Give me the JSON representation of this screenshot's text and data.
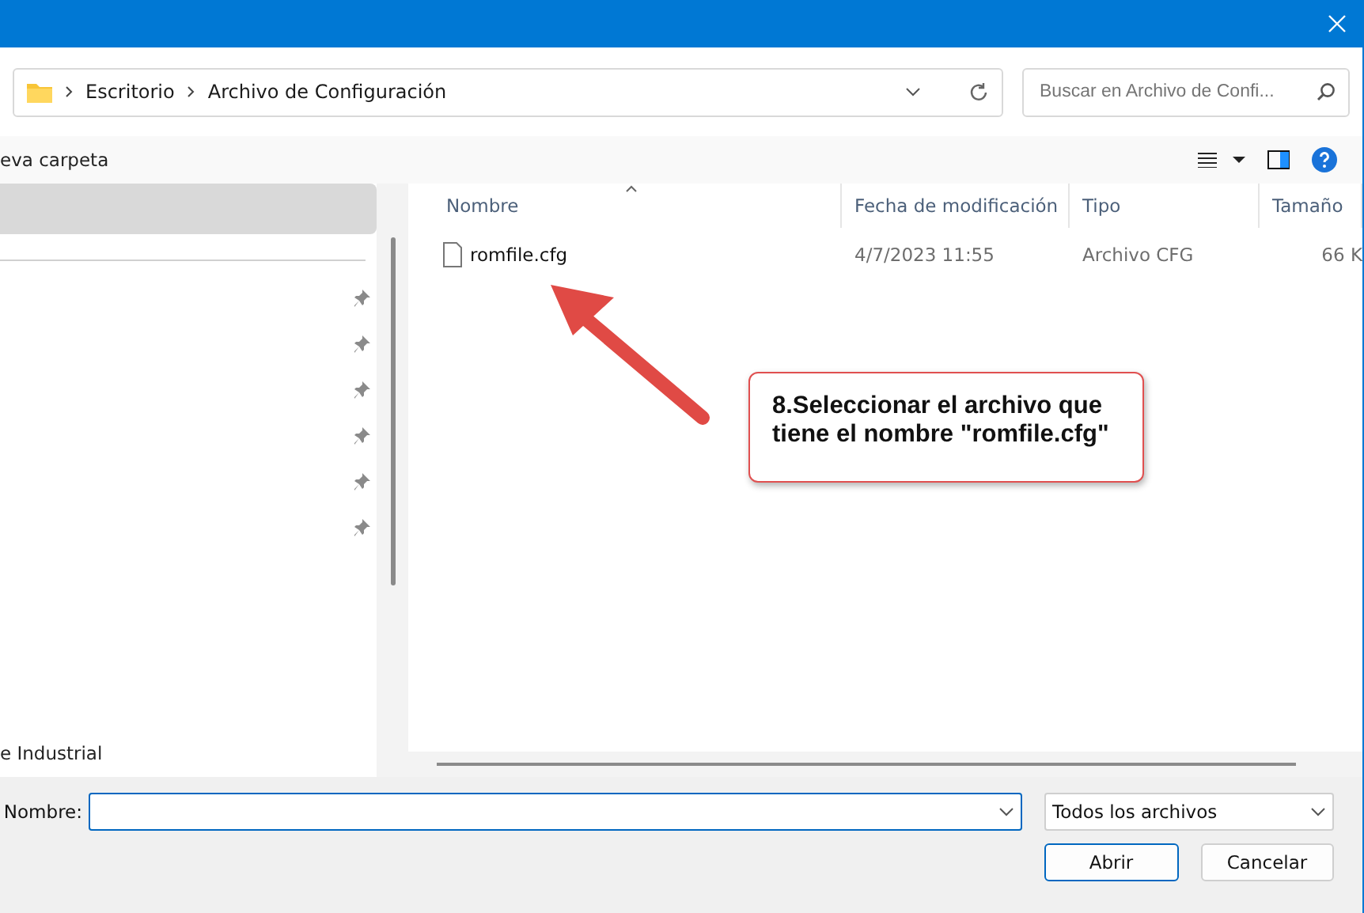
{
  "breadcrumb": [
    "Escritorio",
    "Archivo de Configuración"
  ],
  "search": {
    "placeholder": "Buscar en Archivo de Confi..."
  },
  "toolbar": {
    "new_folder": "eva carpeta"
  },
  "nav": {
    "selected_row": true,
    "bottom_item": "e Industrial"
  },
  "columns": [
    {
      "label": "Nombre",
      "sorted": true
    },
    {
      "label": "Fecha de modificación",
      "sorted": false
    },
    {
      "label": "Tipo",
      "sorted": false
    },
    {
      "label": "Tamaño",
      "sorted": false
    }
  ],
  "rows": [
    {
      "name": "romfile.cfg",
      "date": "4/7/2023 11:55",
      "type": "Archivo CFG",
      "size": "66 K"
    }
  ],
  "file_name": {
    "label": "Nombre:"
  },
  "filter": "Todos los archivos",
  "buttons": [
    {
      "label": "Abrir",
      "kind": "primary"
    },
    {
      "label": "Cancelar",
      "kind": "secondary"
    }
  ],
  "callout": "8.Seleccionar el archivo que tiene el nombre \"romfile.cfg\""
}
